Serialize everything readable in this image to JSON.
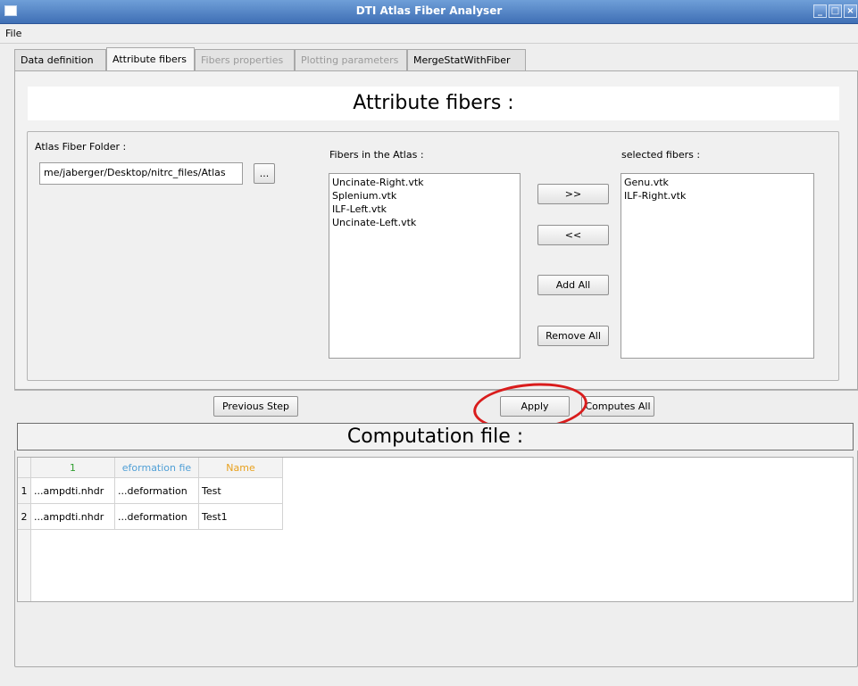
{
  "window": {
    "title": "DTI Atlas Fiber Analyser",
    "minimize_glyph": "_",
    "maximize_glyph": "□",
    "close_glyph": "×"
  },
  "menu": {
    "file_label": "File"
  },
  "tabs": [
    {
      "label": "Data definition",
      "state": "enabled"
    },
    {
      "label": "Attribute fibers",
      "state": "active"
    },
    {
      "label": "Fibers properties",
      "state": "disabled"
    },
    {
      "label": "Plotting parameters",
      "state": "disabled"
    },
    {
      "label": "MergeStatWithFiber",
      "state": "enabled"
    }
  ],
  "attribute": {
    "heading": "Attribute fibers :",
    "atlas_folder_label": "Atlas Fiber Folder :",
    "atlas_folder_value": "me/jaberger/Desktop/nitrc_files/Atlas",
    "browse_label": "...",
    "fibers_in_atlas_label": "Fibers in the Atlas :",
    "fibers_in_atlas": [
      "Uncinate-Right.vtk",
      "Splenium.vtk",
      "ILF-Left.vtk",
      "Uncinate-Left.vtk"
    ],
    "selected_fibers_label": "selected fibers :",
    "selected_fibers": [
      "Genu.vtk",
      "ILF-Right.vtk"
    ],
    "add_label": ">>",
    "remove_label": "<<",
    "add_all_label": "Add All",
    "remove_all_label": "Remove All"
  },
  "nav": {
    "previous_label": "Previous Step",
    "apply_label": "Apply",
    "computes_all_label": "Computes All"
  },
  "computation": {
    "heading": "Computation file :",
    "columns": [
      {
        "label": "1",
        "color": "#2e9e2e"
      },
      {
        "label": "eformation fie",
        "color": "#4f9fd6"
      },
      {
        "label": "Name",
        "color": "#e8a11e"
      }
    ],
    "rows": [
      {
        "index": "1",
        "cells": [
          "...ampdti.nhdr",
          "...deformation",
          "Test"
        ]
      },
      {
        "index": "2",
        "cells": [
          "...ampdti.nhdr",
          "...deformation",
          "Test1"
        ]
      }
    ]
  },
  "colors": {
    "titlebar": "#4f7fc3",
    "annotation": "#d91c1c"
  }
}
